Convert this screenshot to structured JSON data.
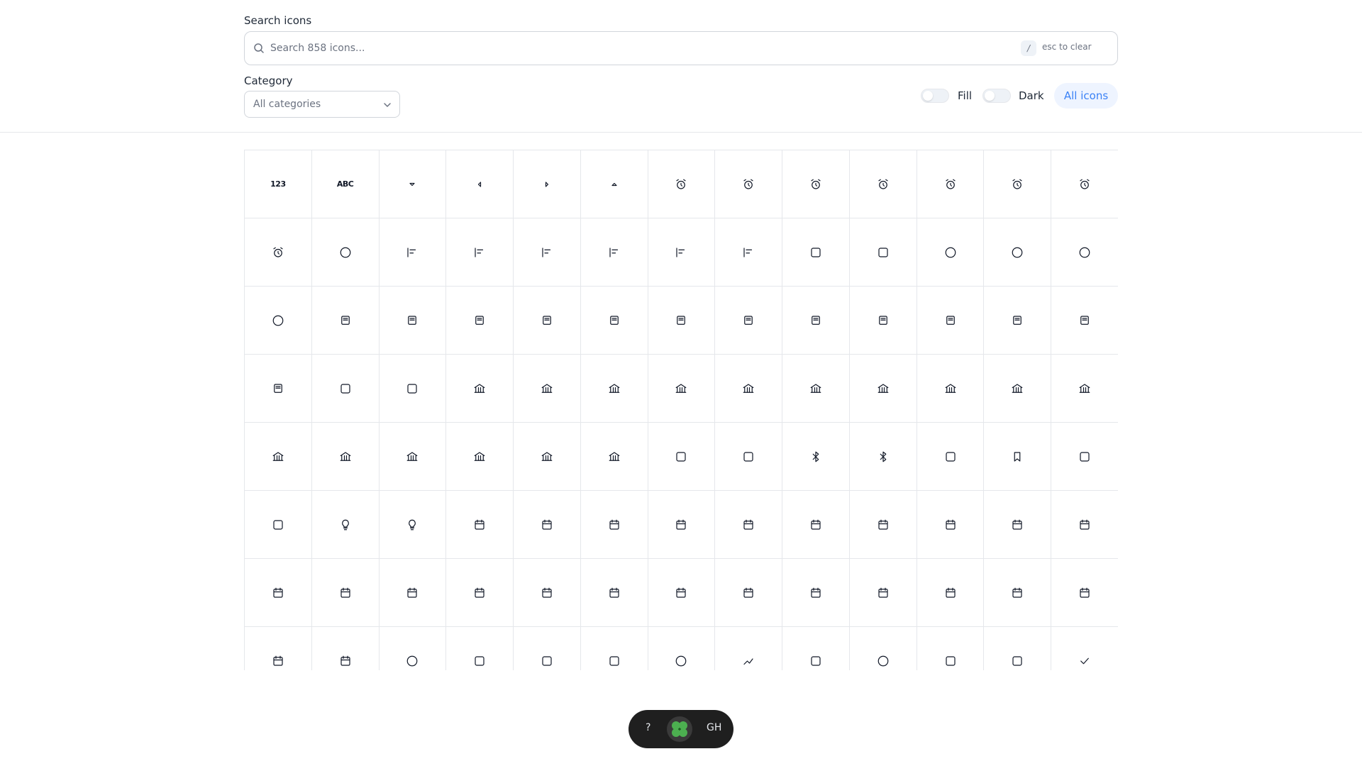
{
  "search": {
    "label": "Search icons",
    "placeholder": "Search 858 icons...",
    "value": "",
    "shortcut_key": "/",
    "clear_hint": "esc to clear"
  },
  "category": {
    "label": "Category",
    "selected": "All categories"
  },
  "toggles": {
    "fill": {
      "label": "Fill",
      "on": false
    },
    "dark": {
      "label": "Dark",
      "on": false
    }
  },
  "all_icons_button": "All icons",
  "colors": {
    "accent": "#3b82f6",
    "accent_bg": "#eef4ff",
    "border": "#e5e7eb",
    "dock_bg": "#1f1f1f",
    "logo_green": "#4caf50"
  },
  "icons": [
    {
      "name": "123",
      "text": "123"
    },
    {
      "name": "abc",
      "text": "ABC"
    },
    {
      "name": "arrow-down-tiny-icon"
    },
    {
      "name": "arrow-left-tiny-icon"
    },
    {
      "name": "arrow-right-tiny-icon"
    },
    {
      "name": "arrow-up-tiny-icon"
    },
    {
      "name": "alarm-icon"
    },
    {
      "name": "alarm-snooze-icon"
    },
    {
      "name": "alarm-plus-icon"
    },
    {
      "name": "alarm-clock-icon"
    },
    {
      "name": "alarm-off-icon"
    },
    {
      "name": "alarm-minus-icon"
    },
    {
      "name": "alarm-smile-icon"
    },
    {
      "name": "alarm-check-icon"
    },
    {
      "name": "alert-circle-icon"
    },
    {
      "name": "align-bottom-icon"
    },
    {
      "name": "align-center-horizontal-icon"
    },
    {
      "name": "align-center-vertical-icon"
    },
    {
      "name": "align-left-icon"
    },
    {
      "name": "align-right-icon"
    },
    {
      "name": "align-top-icon"
    },
    {
      "name": "apple-icon"
    },
    {
      "name": "archive-icon"
    },
    {
      "name": "arrow-circle-down-icon"
    },
    {
      "name": "arrow-circle-left-icon"
    },
    {
      "name": "arrow-circle-right-icon"
    },
    {
      "name": "arrow-circle-up-icon"
    },
    {
      "name": "atm-icon"
    },
    {
      "name": "atm-clock-icon"
    },
    {
      "name": "atm-lock-icon"
    },
    {
      "name": "atm-bank-icon"
    },
    {
      "name": "atm-cash-icon"
    },
    {
      "name": "atm-check-icon"
    },
    {
      "name": "atm-plus-icon"
    },
    {
      "name": "atm-settings-icon"
    },
    {
      "name": "atm-user-icon"
    },
    {
      "name": "atm-heart-icon"
    },
    {
      "name": "atm-search-icon"
    },
    {
      "name": "atm-return-icon"
    },
    {
      "name": "atm-card-icon"
    },
    {
      "name": "attachment-icon"
    },
    {
      "name": "backspace-icon"
    },
    {
      "name": "bank-icon"
    },
    {
      "name": "bank-clock-icon"
    },
    {
      "name": "bank-cash-icon"
    },
    {
      "name": "bank-check-icon"
    },
    {
      "name": "bank-plus-icon"
    },
    {
      "name": "bank-lock-icon"
    },
    {
      "name": "bank-settings-icon"
    },
    {
      "name": "bank-card-icon"
    },
    {
      "name": "bank-alert-icon"
    },
    {
      "name": "bank-edit-icon"
    },
    {
      "name": "bank-pin-icon"
    },
    {
      "name": "bank-user-icon"
    },
    {
      "name": "bank-heart-icon"
    },
    {
      "name": "bank-pencil-icon"
    },
    {
      "name": "bank-list-icon"
    },
    {
      "name": "bank-return-icon"
    },
    {
      "name": "binoculars-icon"
    },
    {
      "name": "block-icon"
    },
    {
      "name": "bluetooth-icon"
    },
    {
      "name": "bluetooth-off-icon"
    },
    {
      "name": "bold-icon"
    },
    {
      "name": "bookmark-icon"
    },
    {
      "name": "bubble-dots-icon"
    },
    {
      "name": "copy-stack-icon"
    },
    {
      "name": "bulb-pin-icon"
    },
    {
      "name": "bulb-icon"
    },
    {
      "name": "calendar-icon"
    },
    {
      "name": "calendar-dots-icon"
    },
    {
      "name": "calendar-lock-icon"
    },
    {
      "name": "calendar-edit-icon"
    },
    {
      "name": "calendar-clock-icon"
    },
    {
      "name": "calendar-settings-icon"
    },
    {
      "name": "calendar-card-icon"
    },
    {
      "name": "calendar-dollar-icon"
    },
    {
      "name": "calendar-mail-icon"
    },
    {
      "name": "calendar-export-icon"
    },
    {
      "name": "calendar-list-icon"
    },
    {
      "name": "calendar-user-icon"
    },
    {
      "name": "calendar-minus-icon"
    },
    {
      "name": "calendar-1-icon"
    },
    {
      "name": "calendar-31-icon"
    },
    {
      "name": "calendar-7-icon"
    },
    {
      "name": "calendar-percent-icon"
    },
    {
      "name": "calendar-play-icon"
    },
    {
      "name": "calendar-plus-icon"
    },
    {
      "name": "calendar-repeat-icon"
    },
    {
      "name": "calendar-search-icon"
    },
    {
      "name": "calendar-gear-icon"
    },
    {
      "name": "calendar-smile-icon"
    },
    {
      "name": "calendar-star-icon"
    },
    {
      "name": "calendar-return-icon"
    },
    {
      "name": "cash-circle-icon"
    },
    {
      "name": "card-clock-icon"
    },
    {
      "name": "card-plus-icon"
    },
    {
      "name": "card-lock-icon"
    },
    {
      "name": "close-circle-icon"
    },
    {
      "name": "chart-line-icon"
    },
    {
      "name": "hierarchy-icon"
    },
    {
      "name": "check-circle-icon"
    },
    {
      "name": "checkbox-checked-icon"
    },
    {
      "name": "checkbox-icon"
    },
    {
      "name": "check-icon"
    }
  ],
  "dock": {
    "help": "?",
    "github": "GH"
  }
}
